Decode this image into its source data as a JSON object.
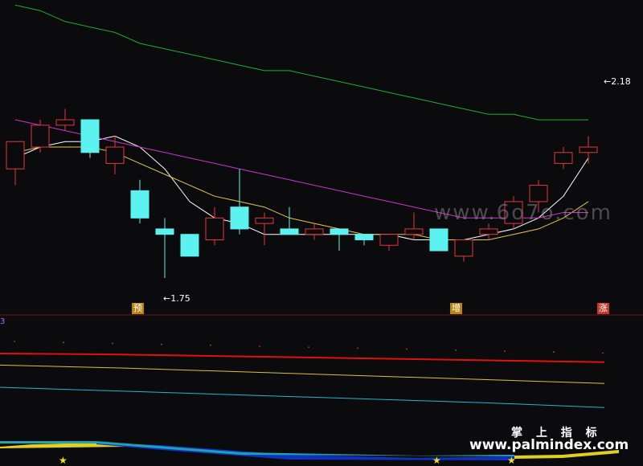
{
  "chart_data": {
    "type": "candlestick",
    "price_panel": {
      "candles": [
        {
          "o": 1.95,
          "h": 1.97,
          "c": 2.0,
          "l": 1.92,
          "dir": "up"
        },
        {
          "o": 1.99,
          "h": 2.04,
          "c": 2.03,
          "l": 1.98,
          "dir": "up"
        },
        {
          "o": 2.03,
          "h": 2.06,
          "c": 2.04,
          "l": 2.02,
          "dir": "up"
        },
        {
          "o": 2.04,
          "h": 2.04,
          "c": 1.98,
          "l": 1.97,
          "dir": "down"
        },
        {
          "o": 1.96,
          "h": 2.01,
          "c": 1.99,
          "l": 1.94,
          "dir": "up"
        },
        {
          "o": 1.91,
          "h": 1.93,
          "c": 1.86,
          "l": 1.85,
          "dir": "down"
        },
        {
          "o": 1.84,
          "h": 1.86,
          "c": 1.83,
          "l": 1.75,
          "dir": "down"
        },
        {
          "o": 1.83,
          "h": 1.83,
          "c": 1.79,
          "l": 1.79,
          "dir": "down"
        },
        {
          "o": 1.82,
          "h": 1.88,
          "c": 1.86,
          "l": 1.81,
          "dir": "up"
        },
        {
          "o": 1.88,
          "h": 1.95,
          "c": 1.84,
          "l": 1.83,
          "dir": "down"
        },
        {
          "o": 1.85,
          "h": 1.87,
          "c": 1.86,
          "l": 1.81,
          "dir": "up"
        },
        {
          "o": 1.84,
          "h": 1.88,
          "c": 1.83,
          "l": 1.83,
          "dir": "down"
        },
        {
          "o": 1.83,
          "h": 1.85,
          "c": 1.84,
          "l": 1.82,
          "dir": "up"
        },
        {
          "o": 1.84,
          "h": 1.84,
          "c": 1.83,
          "l": 1.8,
          "dir": "down"
        },
        {
          "o": 1.83,
          "h": 1.83,
          "c": 1.82,
          "l": 1.81,
          "dir": "down"
        },
        {
          "o": 1.81,
          "h": 1.83,
          "c": 1.83,
          "l": 1.8,
          "dir": "up"
        },
        {
          "o": 1.83,
          "h": 1.87,
          "c": 1.84,
          "l": 1.82,
          "dir": "up"
        },
        {
          "o": 1.84,
          "h": 1.84,
          "c": 1.8,
          "l": 1.8,
          "dir": "down"
        },
        {
          "o": 1.79,
          "h": 1.82,
          "c": 1.82,
          "l": 1.78,
          "dir": "up"
        },
        {
          "o": 1.83,
          "h": 1.85,
          "c": 1.84,
          "l": 1.82,
          "dir": "up"
        },
        {
          "o": 1.85,
          "h": 1.9,
          "c": 1.89,
          "l": 1.84,
          "dir": "up"
        },
        {
          "o": 1.89,
          "h": 1.93,
          "c": 1.92,
          "l": 1.87,
          "dir": "up"
        },
        {
          "o": 1.96,
          "h": 1.99,
          "c": 1.98,
          "l": 1.95,
          "dir": "up"
        },
        {
          "o": 1.98,
          "h": 2.01,
          "c": 1.99,
          "l": 1.96,
          "dir": "up"
        }
      ],
      "ylim": [
        1.7,
        2.23
      ],
      "ma_lines": [
        {
          "color": "#ffffff",
          "values": [
            1.97,
            1.99,
            2.0,
            2.0,
            2.01,
            1.99,
            1.95,
            1.89,
            1.86,
            1.85,
            1.83,
            1.83,
            1.83,
            1.83,
            1.83,
            1.83,
            1.82,
            1.82,
            1.82,
            1.83,
            1.84,
            1.86,
            1.9,
            1.97
          ]
        },
        {
          "color": "#e6c84d",
          "values": [
            1.98,
            1.99,
            1.99,
            1.99,
            1.98,
            1.96,
            1.94,
            1.92,
            1.9,
            1.89,
            1.88,
            1.86,
            1.85,
            1.84,
            1.83,
            1.83,
            1.83,
            1.82,
            1.82,
            1.82,
            1.83,
            1.84,
            1.86,
            1.89
          ]
        },
        {
          "color": "#cc33cc",
          "values": [
            2.04,
            2.03,
            2.02,
            2.01,
            2.0,
            1.99,
            1.98,
            1.97,
            1.96,
            1.95,
            1.94,
            1.93,
            1.92,
            1.91,
            1.9,
            1.89,
            1.88,
            1.87,
            1.86,
            1.86,
            1.86,
            1.86,
            1.87,
            1.87
          ]
        },
        {
          "color": "#22aa33",
          "values": [
            2.25,
            2.24,
            2.22,
            2.21,
            2.2,
            2.18,
            2.17,
            2.16,
            2.15,
            2.14,
            2.13,
            2.13,
            2.12,
            2.11,
            2.1,
            2.09,
            2.08,
            2.07,
            2.06,
            2.05,
            2.05,
            2.04,
            2.04,
            2.04
          ]
        }
      ]
    },
    "indicator_panel": {
      "lines": [
        {
          "name": "red",
          "color": "#e01010",
          "values": [
            1.0,
            0.99,
            0.97,
            0.95,
            0.93,
            0.91
          ]
        },
        {
          "name": "yellow",
          "color": "#d8c040",
          "values": [
            0.88,
            0.85,
            0.81,
            0.77,
            0.73,
            0.69
          ]
        },
        {
          "name": "cyan",
          "color": "#20b8c8",
          "values": [
            0.65,
            0.61,
            0.57,
            0.53,
            0.49,
            0.44
          ]
        }
      ],
      "stars": [
        1,
        16,
        19
      ]
    },
    "annotations": {
      "low": "1.75",
      "high": "2.18",
      "tags": [
        "预",
        "增",
        "涨"
      ]
    }
  },
  "watermark": {
    "site1": "www.6o7o.com",
    "brand": "掌 上 指 标",
    "site2": "www.palmindex.com"
  },
  "panel_label": "3"
}
